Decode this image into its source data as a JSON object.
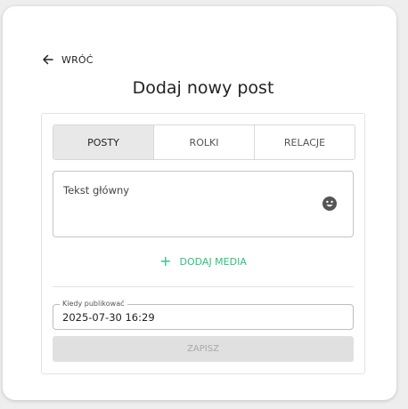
{
  "back": {
    "label": "WRÓĆ"
  },
  "page_title": "Dodaj nowy post",
  "tabs": [
    {
      "label": "POSTY",
      "active": true
    },
    {
      "label": "ROLKI",
      "active": false
    },
    {
      "label": "RELACJE",
      "active": false
    }
  ],
  "main_text": {
    "placeholder": "Tekst główny"
  },
  "add_media": {
    "icon": "plus-icon",
    "label": "DODAJ MEDIA"
  },
  "publish_date": {
    "label": "Kiedy publikować",
    "value": "2025-07-30 16:29"
  },
  "save_button": {
    "label": "ZAPISZ",
    "disabled": true
  },
  "colors": {
    "accent": "#2ec27e",
    "active_tab_bg": "#e8e8e8"
  }
}
